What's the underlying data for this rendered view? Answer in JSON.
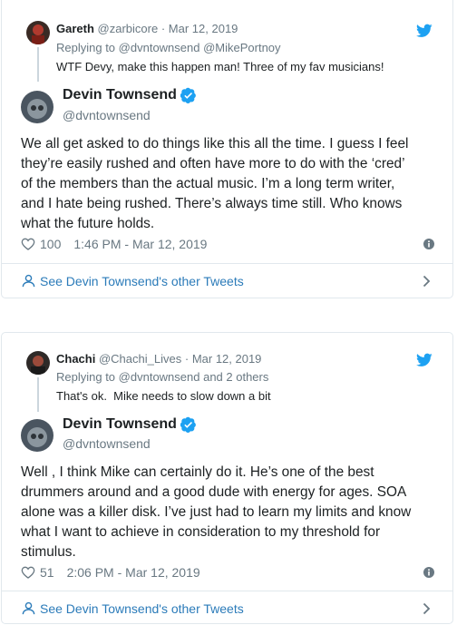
{
  "tweet1": {
    "parent": {
      "name": "Gareth",
      "handle": "@zarbicore",
      "dot": "·",
      "date": "Mar 12, 2019",
      "reply_prefix": "Replying to",
      "reply_mentions": "@dvntownsend @MikePortnoy",
      "text": "WTF Devy, make this happen man! Three of my fav musicians!"
    },
    "author_name": "Devin Townsend",
    "author_handle": "@dvntownsend",
    "body_lines": [
      "We all get asked to do things like this all the time. I guess I feel",
      "they’re easily rushed and often have more to do with the ‘cred’",
      "of the members than the actual music. I’m a long term writer,",
      "and I hate being rushed. There’s always time still. Who knows",
      "what the future holds."
    ],
    "likes": "100",
    "timestamp": "1:46 PM - Mar 12, 2019",
    "see_more": "See Devin Townsend's other Tweets"
  },
  "tweet2": {
    "parent": {
      "name": "Chachi",
      "handle": "@Chachi_Lives",
      "dot": "·",
      "date": "Mar 12, 2019",
      "reply_prefix": "Replying to",
      "reply_mentions": "@dvntownsend and 2 others",
      "text": "That's ok.  Mike needs to slow down a bit"
    },
    "author_name": "Devin Townsend",
    "author_handle": "@dvntownsend",
    "body_lines": [
      "Well , I think Mike can certainly do it. He’s one of the best",
      "drummers around and a good dude with energy for ages. SOA",
      "alone was a killer disk. I’ve just had to learn my limits and know",
      "what I want to achieve in consideration to my threshold for",
      "stimulus."
    ],
    "likes": "51",
    "timestamp": "2:06 PM - Mar 12, 2019",
    "see_more": "See Devin Townsend's other Tweets"
  },
  "colors": {
    "twitter_blue": "#1da1f2",
    "link_blue": "#2b7bb9",
    "muted": "#697882",
    "border": "#e1e8ed",
    "verified": "#1da1f2"
  }
}
